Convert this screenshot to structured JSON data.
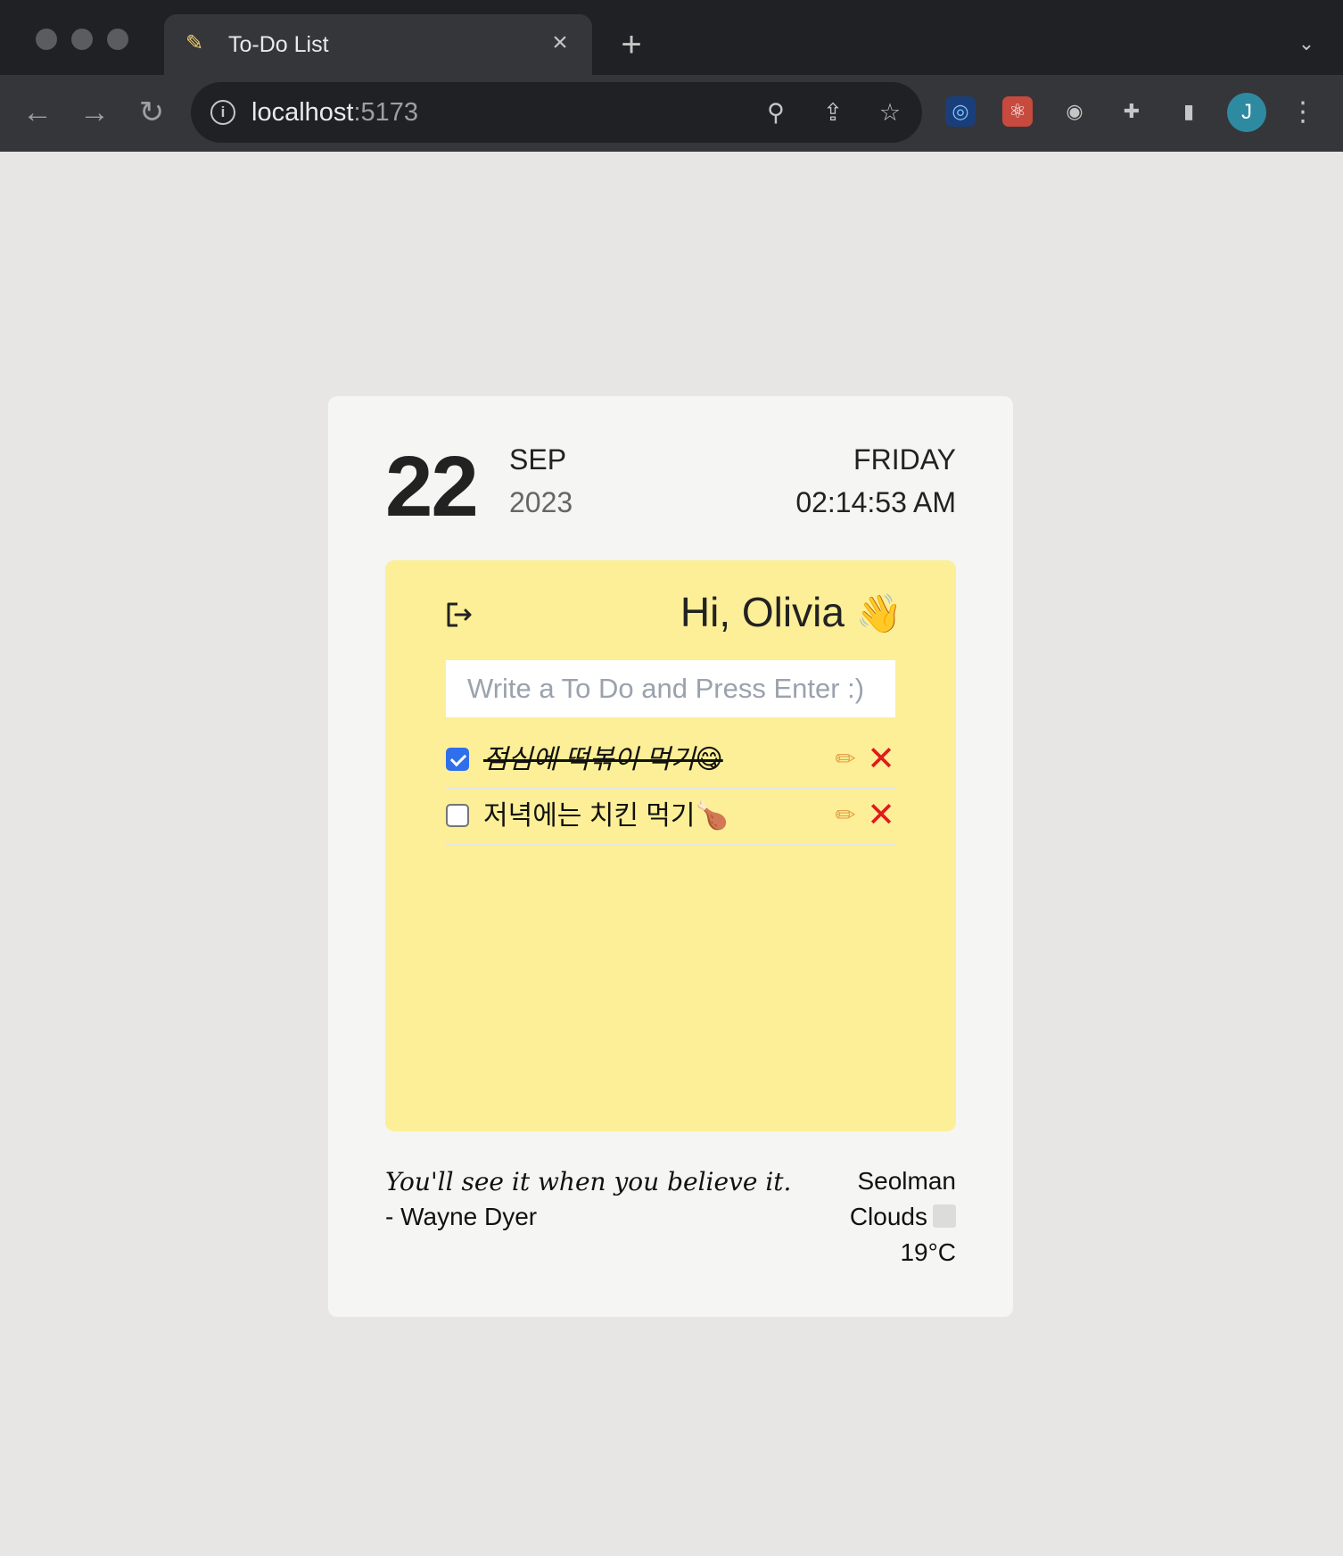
{
  "browser": {
    "tab": {
      "favicon": "memo-icon",
      "title": "To-Do List",
      "close_glyph": "×"
    },
    "new_tab_glyph": "+",
    "url": {
      "host": "localhost",
      "port": ":5173"
    },
    "avatar_initial": "J"
  },
  "clock": {
    "day": "22",
    "month": "SEP",
    "year": "2023",
    "weekday": "FRIDAY",
    "time": "02:14:53 AM"
  },
  "note": {
    "color": "#fcef97",
    "greeting": "Hi, Olivia",
    "greeting_emoji": "👋",
    "input_placeholder": "Write a To Do and Press Enter :)",
    "todos": [
      {
        "text": "점심에 떡볶이 먹기😋",
        "done": true
      },
      {
        "text": "저녁에는 치킨 먹기🍗",
        "done": false
      }
    ],
    "edit_glyph": "✏",
    "delete_glyph": "✕"
  },
  "quote": {
    "text": "You'll see it when you believe it.",
    "author": "- Wayne Dyer"
  },
  "weather": {
    "city": "Seolman",
    "description": "Clouds",
    "temperature": "19°C"
  },
  "colors": {
    "accent_checkbox": "#2f6fec",
    "delete": "#e01b1b",
    "page_bg": "#e7e6e4",
    "card_bg": "#f5f5f3"
  }
}
